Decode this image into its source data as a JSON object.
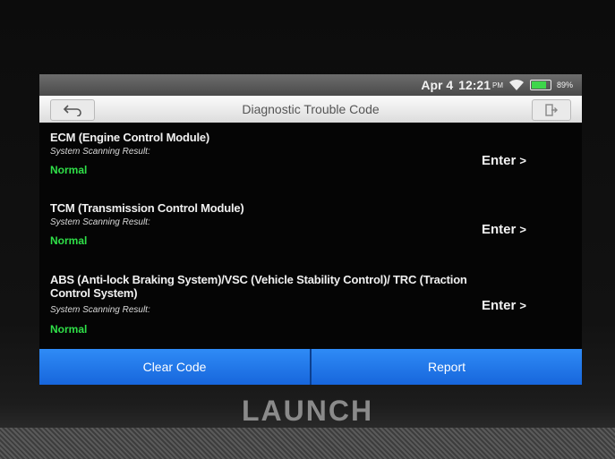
{
  "status": {
    "date": "Apr 4",
    "time": "12:21",
    "ampm": "PM",
    "battery": "89%",
    "battery_level": 0.89
  },
  "header": {
    "title": "Diagnostic Trouble Code"
  },
  "modules": [
    {
      "name": "ECM (Engine Control Module)",
      "result_label": "System Scanning Result:",
      "status": "Normal",
      "action": "Enter"
    },
    {
      "name": "TCM (Transmission Control Module)",
      "result_label": "System Scanning Result:",
      "status": "Normal",
      "action": "Enter"
    },
    {
      "name": "ABS (Anti-lock Braking System)/VSC (Vehicle Stability Control)/ TRC (Traction Control System)",
      "result_label": "System Scanning Result:",
      "status": "Normal",
      "action": "Enter"
    }
  ],
  "actions": {
    "clear_code": "Clear Code",
    "report": "Report"
  },
  "brand": "LAUNCH",
  "colors": {
    "accent": "#1f78e8",
    "status_ok": "#2fe048"
  },
  "icons": [
    "back-arrow-icon",
    "exit-icon",
    "wifi-icon",
    "battery-icon",
    "chevron-right-icon"
  ]
}
